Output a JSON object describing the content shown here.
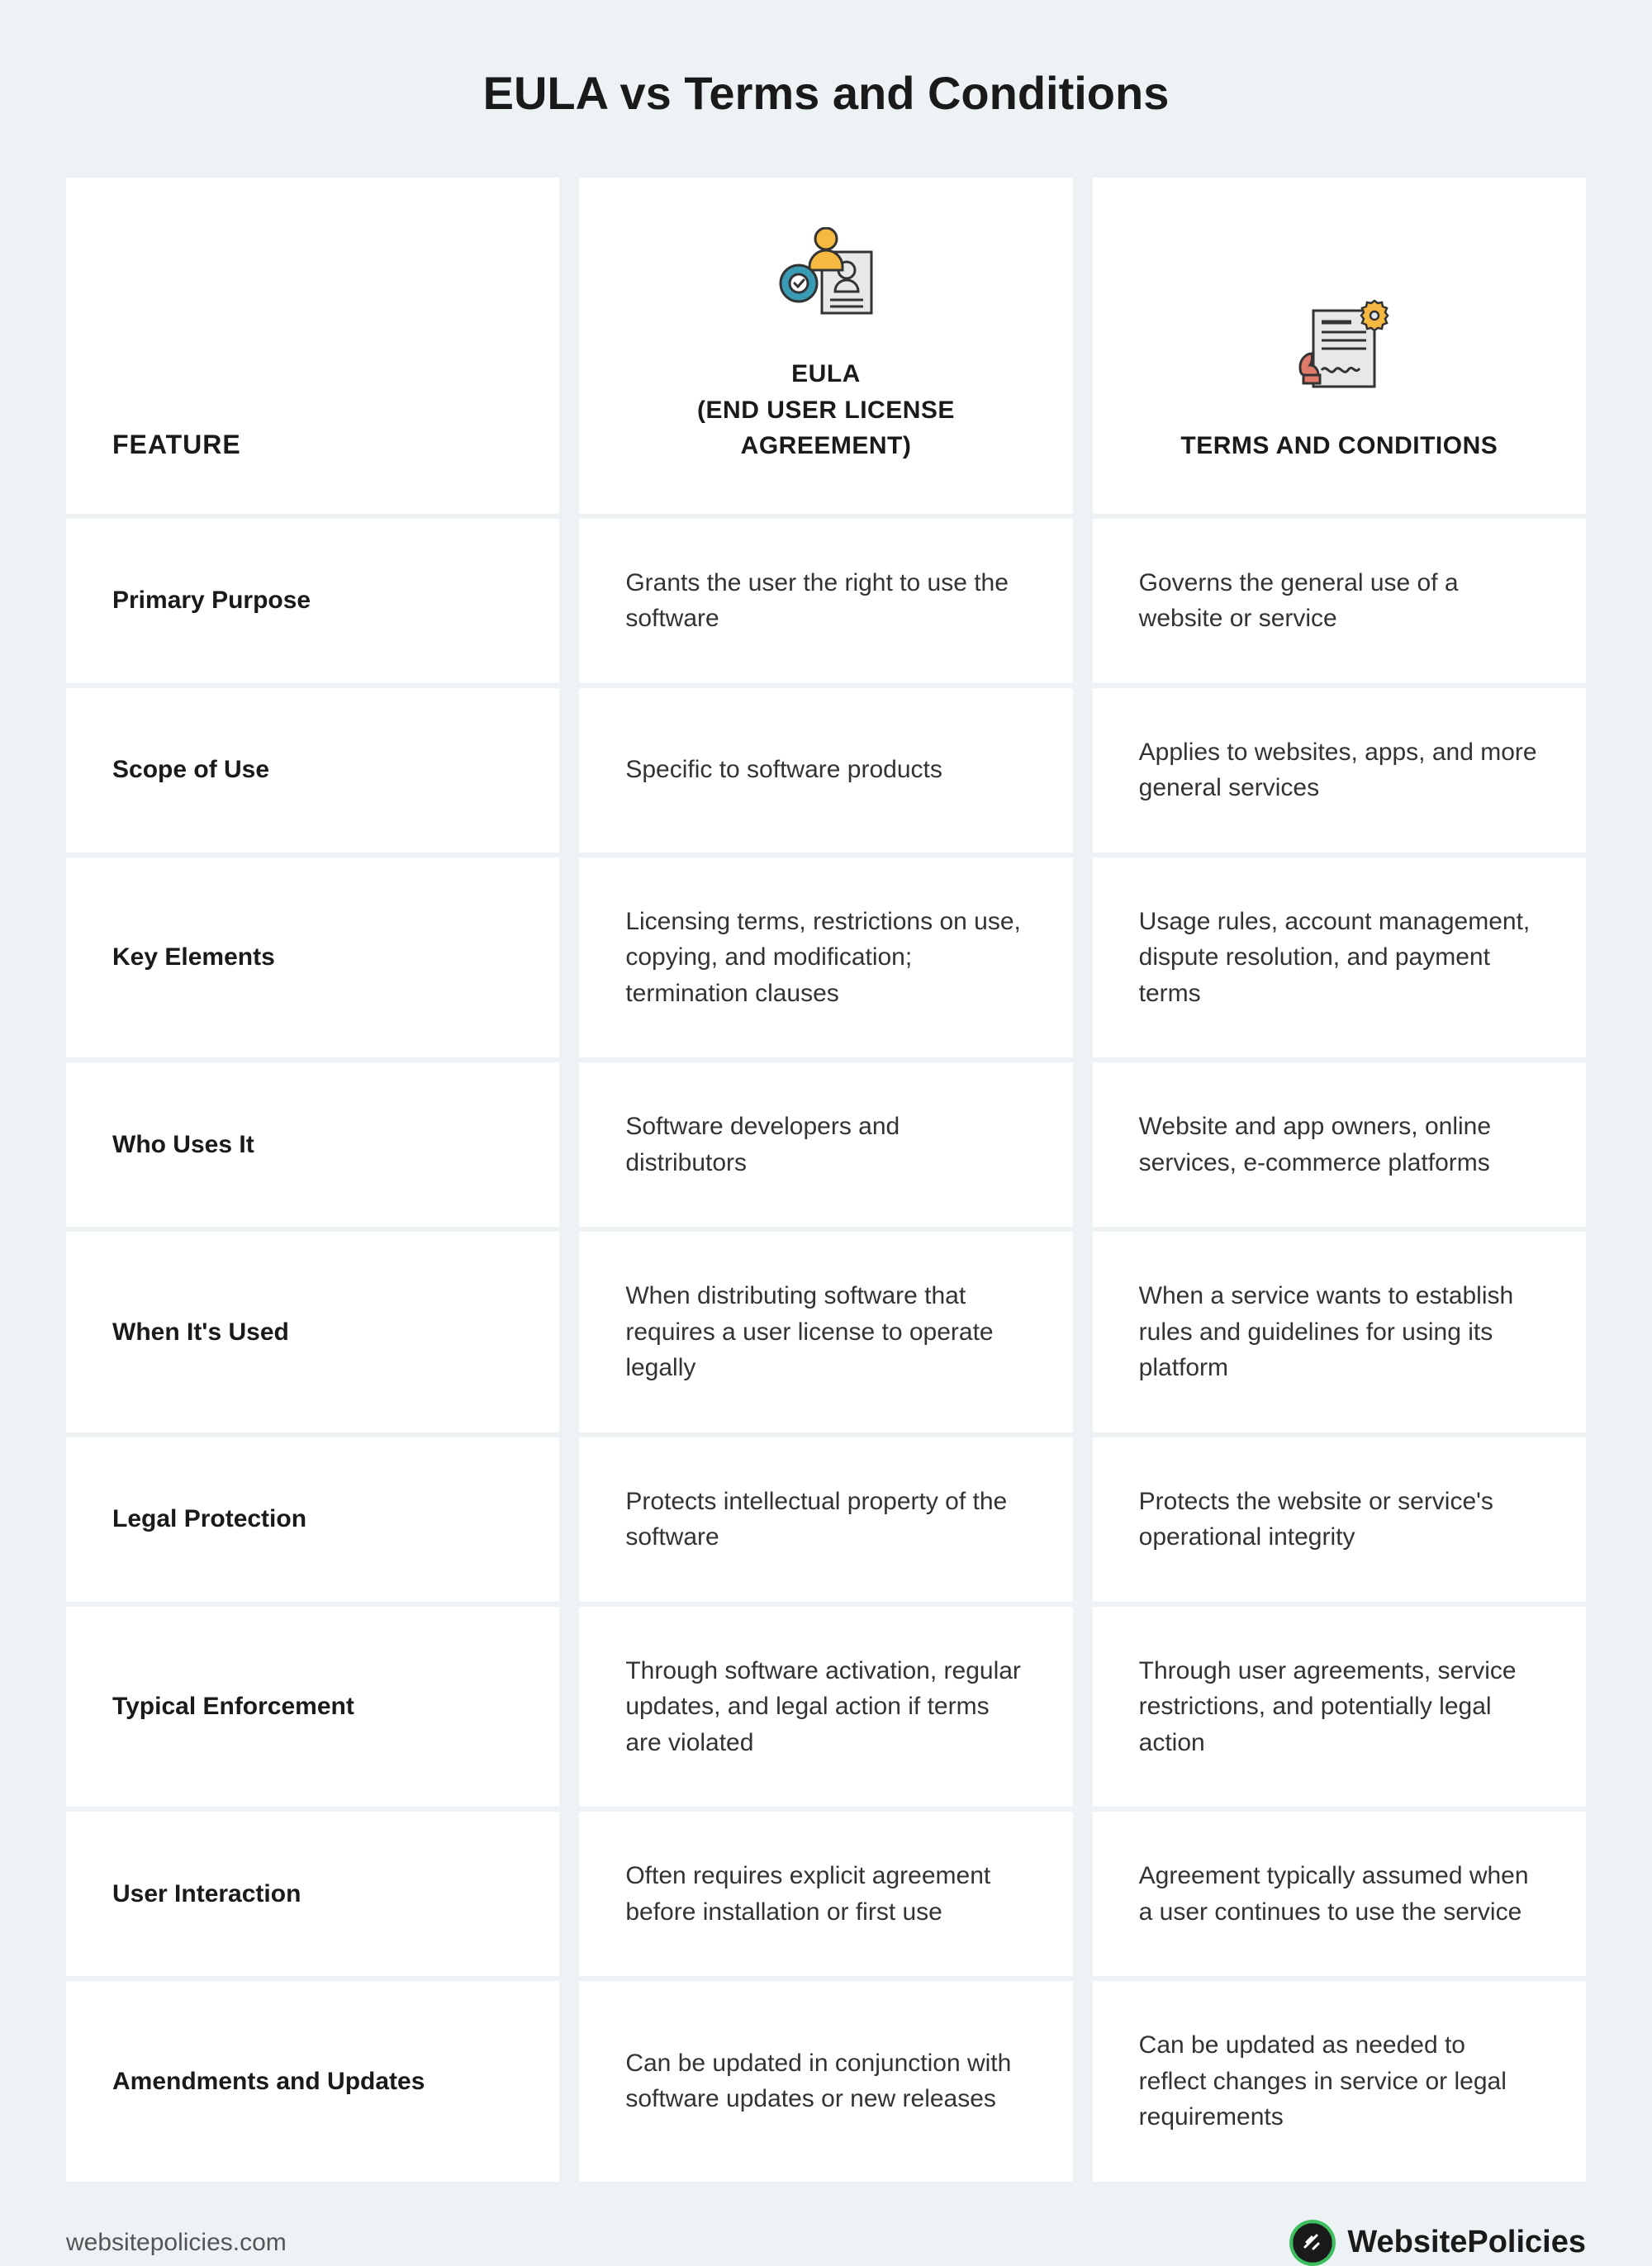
{
  "title": "EULA vs Terms and Conditions",
  "headers": {
    "feature": "FEATURE",
    "eula_line1": "EULA",
    "eula_line2": "(END USER LICENSE AGREEMENT)",
    "terms": "TERMS AND CONDITIONS"
  },
  "rows": [
    {
      "feature": "Primary Purpose",
      "eula": "Grants the user the right to use the software",
      "terms": "Governs the general use of a website or service"
    },
    {
      "feature": "Scope of Use",
      "eula": "Specific to software products",
      "terms": "Applies to websites, apps, and more general services"
    },
    {
      "feature": "Key Elements",
      "eula": "Licensing terms, restrictions on use, copying, and modification; termination clauses",
      "terms": "Usage rules, account management, dispute resolution, and payment terms"
    },
    {
      "feature": "Who Uses It",
      "eula": "Software developers and distributors",
      "terms": "Website and app owners, online services, e-commerce platforms"
    },
    {
      "feature": "When It's Used",
      "eula": "When distributing software that requires a user license to operate legally",
      "terms": "When a service wants to establish rules and guidelines for using its platform"
    },
    {
      "feature": "Legal Protection",
      "eula": "Protects intellectual property of the software",
      "terms": "Protects the website or service's operational integrity"
    },
    {
      "feature": "Typical Enforcement",
      "eula": "Through software activation, regular updates, and legal action if terms are violated",
      "terms": "Through user agreements, service restrictions, and potentially legal action"
    },
    {
      "feature": "User Interaction",
      "eula": "Often requires explicit agreement before installation or first use",
      "terms": "Agreement typically assumed when a user continues to use the service"
    },
    {
      "feature": "Amendments and Updates",
      "eula": "Can be updated in conjunction with software updates or new releases",
      "terms": "Can be updated as needed to reflect changes in service or legal requirements"
    }
  ],
  "footer": {
    "url": "websitepolicies.com",
    "brand": "WebsitePolicies"
  }
}
